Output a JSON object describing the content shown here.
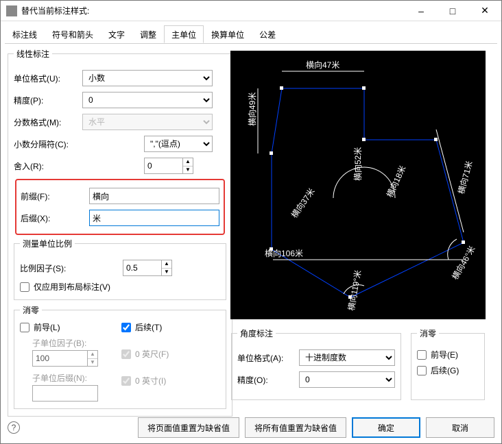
{
  "title": "替代当前标注样式:",
  "tabs": [
    "标注线",
    "符号和箭头",
    "文字",
    "调整",
    "主单位",
    "换算单位",
    "公差"
  ],
  "activeTab": "主单位",
  "linear": {
    "legend": "线性标注",
    "unitFormatLabel": "单位格式(U):",
    "unitFormat": "小数",
    "precisionLabel": "精度(P):",
    "precision": "0",
    "fractionFormatLabel": "分数格式(M):",
    "fractionFormat": "水平",
    "decimalSepLabel": "小数分隔符(C):",
    "decimalSep": "\",\"(逗点)",
    "roundLabel": "舍入(R):",
    "round": "0",
    "prefixLabel": "前缀(F):",
    "prefix": "横向",
    "suffixLabel": "后缀(X):",
    "suffix": "米"
  },
  "scale": {
    "legend": "测量单位比例",
    "factorLabel": "比例因子(S):",
    "factor": "0.5",
    "layoutOnly": "仅应用到布局标注(V)"
  },
  "zero": {
    "legend": "消零",
    "leading": "前导(L)",
    "trailing": "后续(T)",
    "subFactorLabel": "子单位因子(B):",
    "subFactor": "100",
    "subSuffixLabel": "子单位后缀(N):",
    "feet": "0 英尺(F)",
    "inch": "0 英寸(I)"
  },
  "angular": {
    "legend": "角度标注",
    "unitFormatLabel": "单位格式(A):",
    "unitFormat": "十进制度数",
    "precisionLabel": "精度(O):",
    "precision": "0",
    "zeroLegend": "消零",
    "leading": "前导(E)",
    "trailing": "后续(G)"
  },
  "preview": {
    "d1": "横向47米",
    "d2": "横向49米",
    "d3": "横向52米",
    "d4": "横向37米",
    "d5": "横向18米",
    "d6": "横向71米",
    "d7": "横向106米",
    "a1": "横向119°米",
    "a2": "横向46°米"
  },
  "footer": {
    "resetPage": "将页面值重置为缺省值",
    "resetAll": "将所有值重置为缺省值",
    "ok": "确定",
    "cancel": "取消"
  }
}
